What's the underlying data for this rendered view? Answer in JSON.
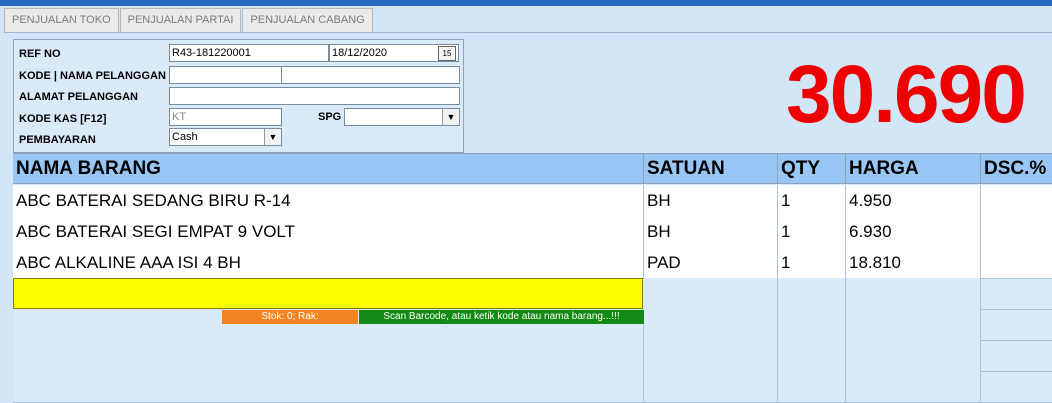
{
  "tabs": [
    "PENJUALAN TOKO",
    "PENJUALAN PARTAI",
    "PENJUALAN CABANG"
  ],
  "form": {
    "ref_no_label": "REF NO",
    "ref_no_value": "R43-181220001",
    "date_value": "18/12/2020",
    "calendar_glyph": "15",
    "pelanggan_label": "KODE | NAMA PELANGGAN",
    "kode_pelanggan_value": "",
    "nama_pelanggan_value": "",
    "alamat_label": "ALAMAT PELANGGAN",
    "alamat_value": "",
    "kode_kas_label": "KODE KAS [F12]",
    "kode_kas_value": "KT",
    "spg_label": "SPG",
    "spg_value": "",
    "pembayaran_label": "PEMBAYARAN",
    "pembayaran_value": "Cash"
  },
  "total": "30.690",
  "table": {
    "headers": [
      "NAMA BARANG",
      "SATUAN",
      "QTY",
      "HARGA",
      "DSC.%"
    ],
    "rows": [
      {
        "nama": "ABC BATERAI SEDANG BIRU R-14",
        "satuan": "BH",
        "qty": "1",
        "harga": "4.950",
        "dsc": ""
      },
      {
        "nama": "ABC BATERAI SEGI EMPAT 9 VOLT",
        "satuan": "BH",
        "qty": "1",
        "harga": "6.930",
        "dsc": ""
      },
      {
        "nama": "ABC ALKALINE AAA ISI 4 BH",
        "satuan": "PAD",
        "qty": "1",
        "harga": "18.810",
        "dsc": ""
      }
    ]
  },
  "entry": {
    "value": "",
    "stok_text": "Stok: 0; Rak:",
    "hint_text": "Scan Barcode, atau ketik kode atau nama barang...!!!"
  },
  "colors": {
    "total": "#ee0000",
    "entry_bg": "#ffff00",
    "stok_bg": "#f28421",
    "hint_bg": "#138a13",
    "header_bg": "#99c7f5"
  }
}
